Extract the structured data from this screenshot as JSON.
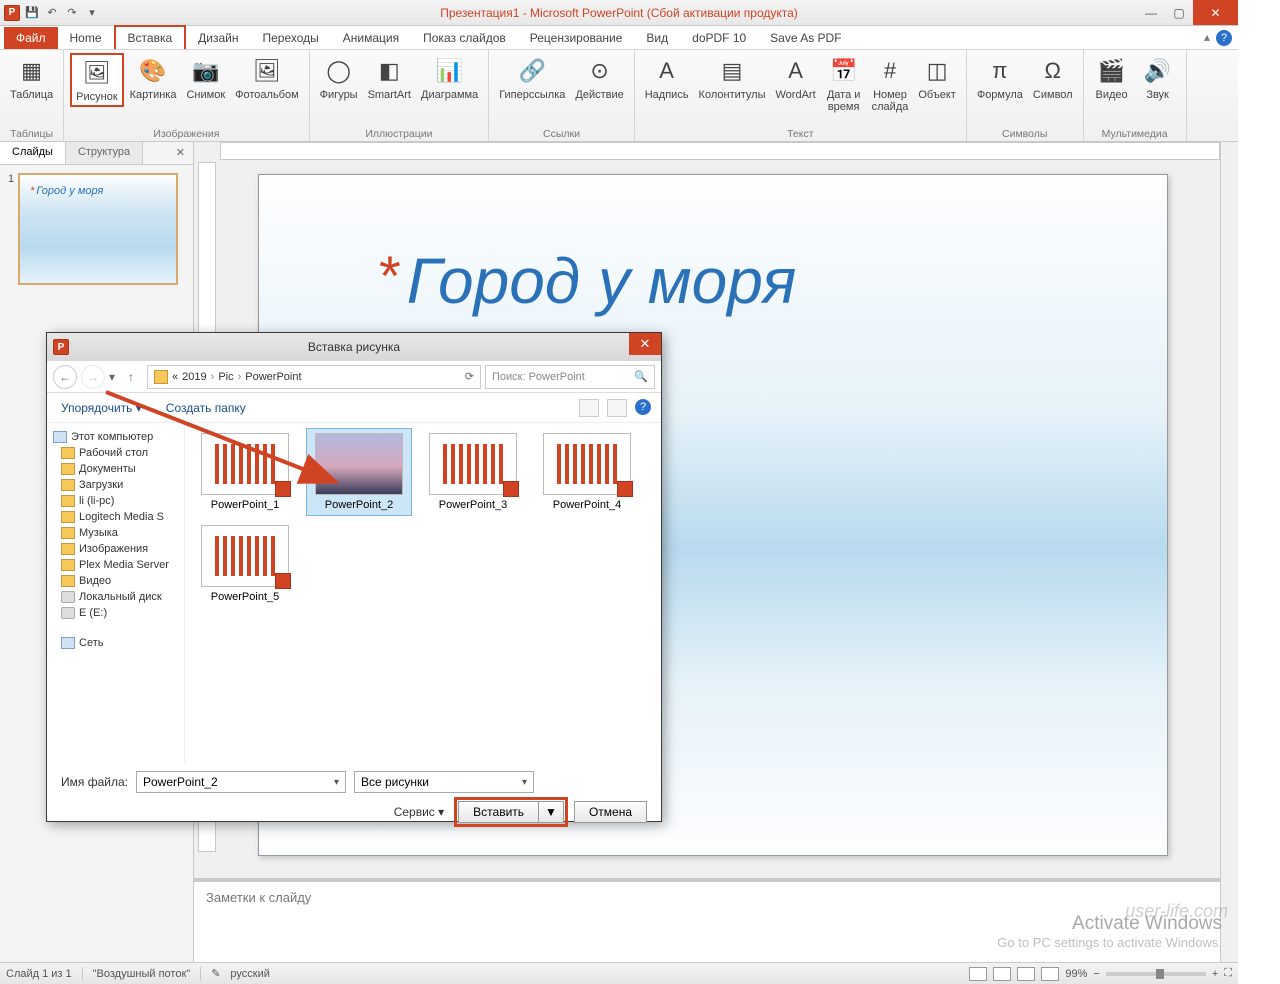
{
  "titlebar": {
    "title": "Презентация1 - Microsoft PowerPoint (Сбой активации продукта)"
  },
  "tabs": {
    "file": "Файл",
    "items": [
      "Home",
      "Вставка",
      "Дизайн",
      "Переходы",
      "Анимация",
      "Показ слайдов",
      "Рецензирование",
      "Вид",
      "doPDF 10",
      "Save As PDF"
    ],
    "active_index": 1
  },
  "ribbon": {
    "groups": [
      {
        "label": "Таблицы",
        "buttons": [
          {
            "t": "Таблица"
          }
        ]
      },
      {
        "label": "Изображения",
        "buttons": [
          {
            "t": "Рисунок",
            "hl": true
          },
          {
            "t": "Картинка"
          },
          {
            "t": "Снимок"
          },
          {
            "t": "Фотоальбом"
          }
        ]
      },
      {
        "label": "Иллюстрации",
        "buttons": [
          {
            "t": "Фигуры"
          },
          {
            "t": "SmartArt"
          },
          {
            "t": "Диаграмма"
          }
        ]
      },
      {
        "label": "Ссылки",
        "buttons": [
          {
            "t": "Гиперссылка"
          },
          {
            "t": "Действие"
          }
        ]
      },
      {
        "label": "Текст",
        "buttons": [
          {
            "t": "Надпись"
          },
          {
            "t": "Колонтитулы"
          },
          {
            "t": "WordArt"
          },
          {
            "t": "Дата и\nвремя"
          },
          {
            "t": "Номер\nслайда"
          },
          {
            "t": "Объект"
          }
        ]
      },
      {
        "label": "Символы",
        "buttons": [
          {
            "t": "Формула"
          },
          {
            "t": "Символ"
          }
        ]
      },
      {
        "label": "Мультимедиа",
        "buttons": [
          {
            "t": "Видео"
          },
          {
            "t": "Звук"
          }
        ]
      }
    ]
  },
  "left_panel": {
    "tab_slides": "Слайды",
    "tab_outline": "Структура",
    "thumb_title": "Город у моря",
    "num": "1"
  },
  "slide": {
    "title": "Город у моря"
  },
  "notes": {
    "placeholder": "Заметки к слайду"
  },
  "dialog": {
    "title": "Вставка рисунка",
    "path": [
      "2019",
      "Pic",
      "PowerPoint"
    ],
    "search_placeholder": "Поиск: PowerPoint",
    "organize": "Упорядочить",
    "new_folder": "Создать папку",
    "tree_top": "Этот компьютер",
    "tree": [
      "Рабочий стол",
      "Документы",
      "Загрузки",
      "li (li-pc)",
      "Logitech Media S",
      "Музыка",
      "Изображения",
      "Plex Media Server",
      "Видео",
      "Локальный диск",
      "E (E:)"
    ],
    "tree_net": "Сеть",
    "files": [
      {
        "name": "PowerPoint_1"
      },
      {
        "name": "PowerPoint_2",
        "sel": true,
        "img": true
      },
      {
        "name": "PowerPoint_3"
      },
      {
        "name": "PowerPoint_4"
      },
      {
        "name": "PowerPoint_5"
      }
    ],
    "filename_label": "Имя файла:",
    "filename_value": "PowerPoint_2",
    "filter": "Все рисунки",
    "service": "Сервис",
    "insert": "Вставить",
    "cancel": "Отмена"
  },
  "status": {
    "slide": "Слайд 1 из 1",
    "theme": "\"Воздушный поток\"",
    "lang": "русский",
    "zoom": "99%"
  },
  "watermark": {
    "l1": "Activate Windows",
    "l2": "Go to PC settings to activate Windows.",
    "site": "user-life.com"
  }
}
